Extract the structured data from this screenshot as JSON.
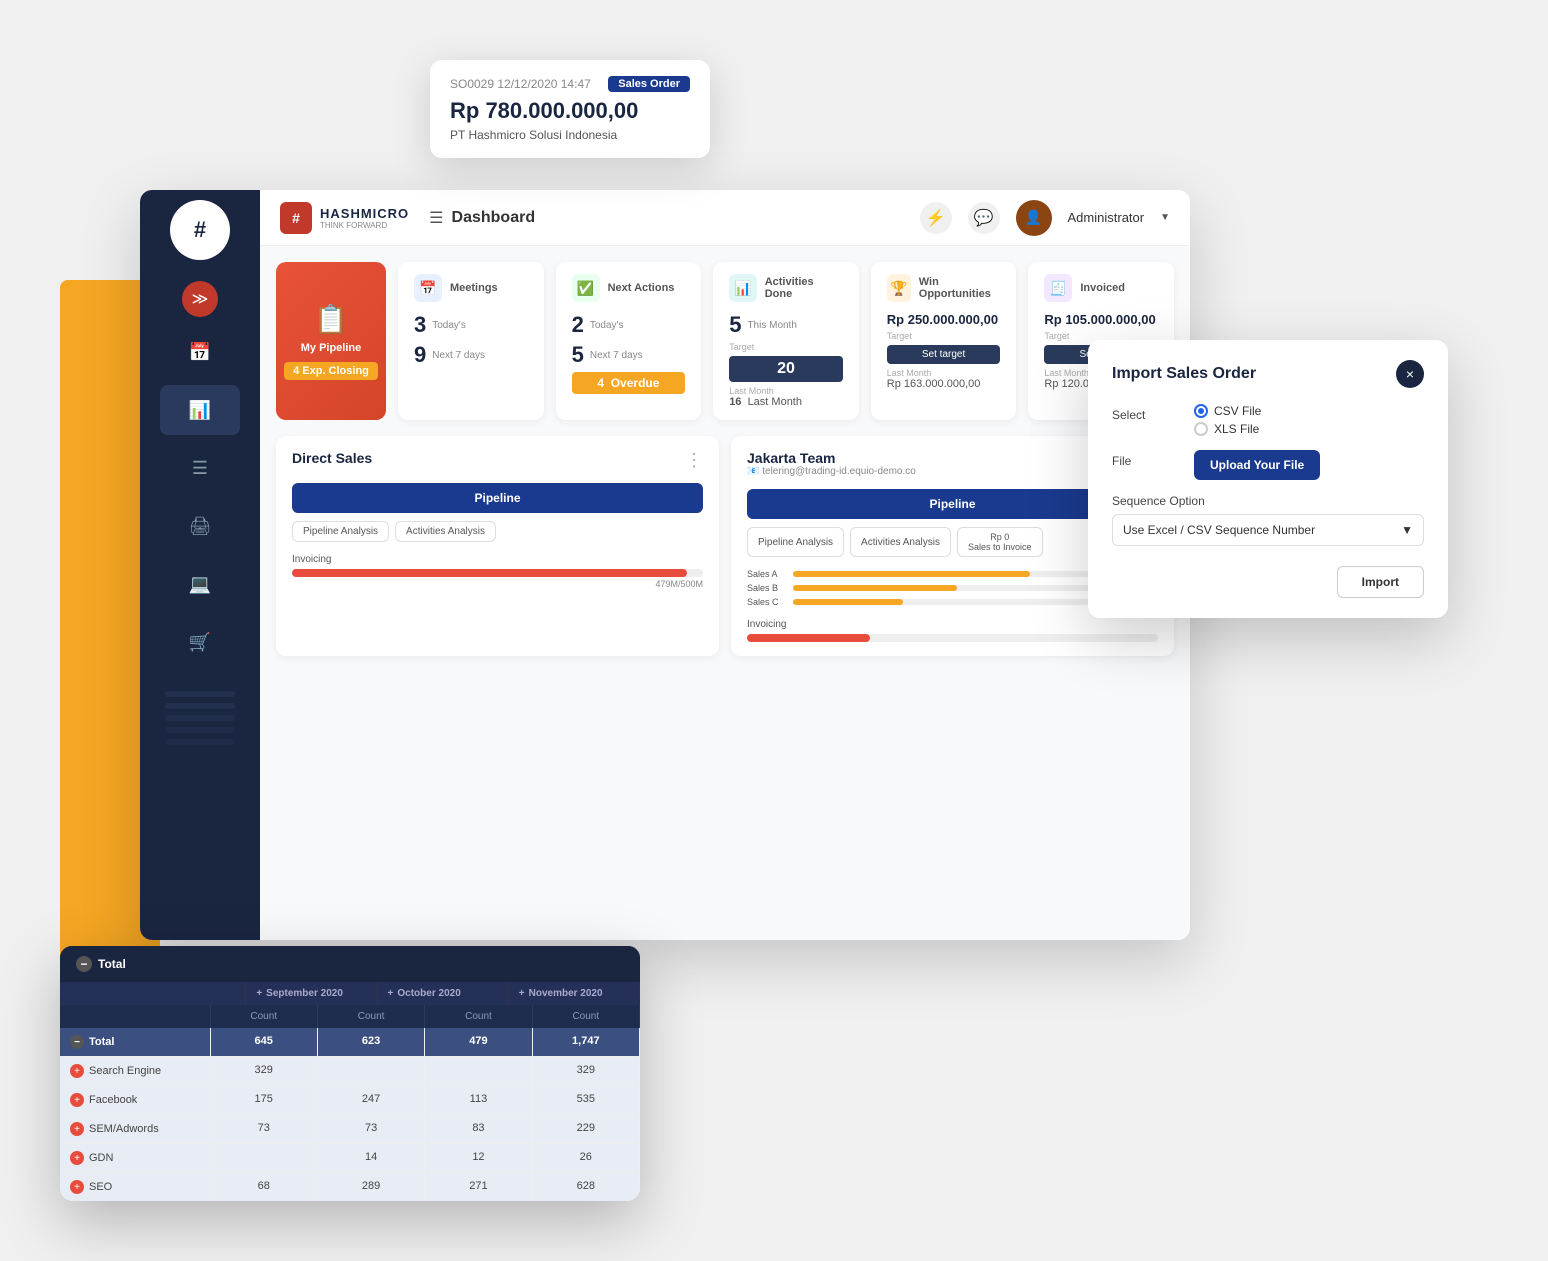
{
  "app": {
    "title": "Dashboard",
    "brand": {
      "name": "HASHMICRO",
      "tagline": "THINK FORWARD",
      "logo_char": "#"
    },
    "admin_label": "Administrator"
  },
  "tooltip": {
    "ref": "SO0029 12/12/2020 14:47",
    "badge": "Sales Order",
    "amount": "Rp 780.000.000,00",
    "company": "PT Hashmicro Solusi Indonesia"
  },
  "kpi": {
    "my_pipeline": {
      "label": "My Pipeline",
      "exp_closing": "4  Exp. Closing"
    },
    "meetings": {
      "title": "Meetings",
      "today_count": "3",
      "today_label": "Today's",
      "next7_count": "9",
      "next7_label": "Next 7 days"
    },
    "next_actions": {
      "title": "Next Actions",
      "today_count": "2",
      "today_label": "Today's",
      "next7_count": "5",
      "next7_label": "Next 7 days",
      "overdue_count": "4",
      "overdue_label": "Overdue"
    },
    "activities_done": {
      "title": "Activities Done",
      "this_month_count": "5",
      "this_month_label": "This Month",
      "target_label": "Target",
      "target_value": "20",
      "last_month_label": "Last Month",
      "last_month_count": "16",
      "last_month_sublabel": "Last Month"
    },
    "win_opportunities": {
      "title": "Win Opportunities",
      "amount": "Rp 250.000.000,00",
      "target_label": "Target",
      "set_target": "Set target",
      "last_month_label": "Last Month",
      "last_month_value": "Rp 163.000.000,00"
    },
    "invoiced": {
      "title": "Invoiced",
      "amount": "Rp 105.000.000,00",
      "target_label": "Target",
      "set_target": "Set target",
      "last_month_label": "Last Month",
      "last_month_value": "Rp 120.000.000,00"
    }
  },
  "direct_sales": {
    "title": "Direct Sales",
    "pipeline_btn": "Pipeline",
    "pipeline_analysis_btn": "Pipeline Analysis",
    "activities_analysis_btn": "Activities Analysis",
    "invoicing_label": "Invoicing",
    "invoicing_bar_value": "479M/500M",
    "invoicing_bar_pct": 96
  },
  "jakarta_team": {
    "title": "Jakarta Team",
    "email": "telering@trading-id.equio-demo.co",
    "pipeline_btn": "Pipeline",
    "pipeline_analysis_btn": "Pipeline Analysis",
    "activities_analysis_btn": "Activities Analysis",
    "sales_to_invoice_btn": "Rp 0\nSales to Invoice",
    "invoicing_label": "Invoicing",
    "sales_bars": [
      {
        "label": "Sales A",
        "pct": 65
      },
      {
        "label": "Sales B",
        "pct": 45
      },
      {
        "label": "Sales C",
        "pct": 30
      }
    ]
  },
  "import_modal": {
    "title": "Import Sales Order",
    "close_icon": "×",
    "select_label": "Select",
    "csv_option": "CSV File",
    "xls_option": "XLS File",
    "file_label": "File",
    "upload_btn": "Upload Your File",
    "sequence_label": "Sequence Option",
    "sequence_value": "Use Excel / CSV Sequence Number",
    "import_btn": "Import"
  },
  "data_table": {
    "header": "Total",
    "collapse_icon": "−",
    "col_groups": [
      {
        "label": "+ September 2020"
      },
      {
        "label": "+ October 2020"
      },
      {
        "label": "+ November 2020"
      }
    ],
    "col_headers": [
      "Count",
      "Count",
      "Count",
      "Count"
    ],
    "rows": [
      {
        "label": "Total",
        "type": "total",
        "icon": "minus",
        "cols": [
          "645",
          "623",
          "479",
          "1,747"
        ]
      },
      {
        "label": "Search Engine",
        "type": "sub",
        "icon": "plus",
        "cols": [
          "329",
          "",
          "",
          "329"
        ]
      },
      {
        "label": "Facebook",
        "type": "sub",
        "icon": "plus",
        "cols": [
          "175",
          "247",
          "113",
          "535"
        ]
      },
      {
        "label": "SEM/Adwords",
        "type": "sub",
        "icon": "plus",
        "cols": [
          "73",
          "73",
          "83",
          "229"
        ]
      },
      {
        "label": "GDN",
        "type": "sub",
        "icon": "plus",
        "cols": [
          "",
          "14",
          "12",
          "26"
        ]
      },
      {
        "label": "SEO",
        "type": "sub",
        "icon": "plus",
        "cols": [
          "68",
          "289",
          "271",
          "628"
        ]
      }
    ]
  },
  "sidebar": {
    "items": [
      {
        "icon": "≫",
        "label": "nav-double-arrow",
        "active": true
      },
      {
        "icon": "📅",
        "label": "nav-calendar"
      },
      {
        "icon": "📊",
        "label": "nav-chart"
      },
      {
        "icon": "📋",
        "label": "nav-list"
      },
      {
        "icon": "🖨",
        "label": "nav-print"
      },
      {
        "icon": "💻",
        "label": "nav-monitor"
      },
      {
        "icon": "🛒",
        "label": "nav-cart"
      }
    ]
  }
}
